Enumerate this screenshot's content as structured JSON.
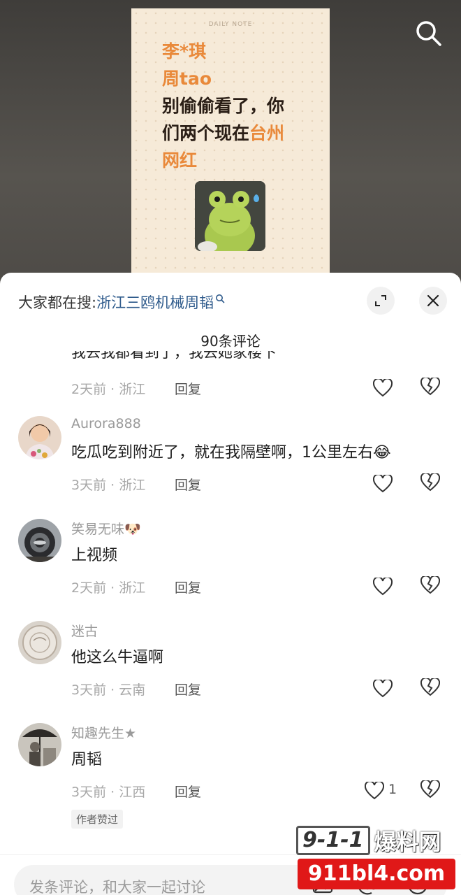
{
  "video": {
    "note_header": "DAILY NOTE",
    "lines": [
      {
        "parts": [
          {
            "text": "李*琪",
            "orange": true
          }
        ]
      },
      {
        "parts": [
          {
            "text": "周tao",
            "orange": true
          }
        ]
      },
      {
        "parts": [
          {
            "text": "别偷偷看了，你",
            "orange": false
          }
        ]
      },
      {
        "parts": [
          {
            "text": "们两个现在",
            "orange": false
          },
          {
            "text": "台州",
            "orange": true
          }
        ]
      },
      {
        "parts": [
          {
            "text": "网红",
            "orange": true
          }
        ]
      }
    ],
    "search_icon": "search-icon"
  },
  "sheet": {
    "hot_search_label": "大家都在搜:",
    "hot_search_query": "浙江三鸥机械周韬",
    "expand_icon": "expand-icon",
    "close_icon": "close-icon",
    "comment_count": "90条评论"
  },
  "partial_comment": {
    "text": "我去我都看到了，我去她家楼下",
    "meta": "2天前 · 浙江",
    "reply": "回复"
  },
  "comments": [
    {
      "name": "Aurora888",
      "text": "吃瓜吃到附近了，就在我隔壁啊，1公里左右😂",
      "meta": "3天前 · 浙江",
      "reply": "回复",
      "likes": "",
      "author_liked": ""
    },
    {
      "name": "笑易无味🐶",
      "text": "上视频",
      "meta": "2天前 · 浙江",
      "reply": "回复",
      "likes": "",
      "author_liked": ""
    },
    {
      "name": "迷古",
      "text": "他这么牛逼啊",
      "meta": "3天前 · 云南",
      "reply": "回复",
      "likes": "",
      "author_liked": ""
    },
    {
      "name": "知趣先生★",
      "text": "周韬",
      "meta": "3天前 · 江西",
      "reply": "回复",
      "likes": "1",
      "author_liked": "作者赞过"
    }
  ],
  "input": {
    "placeholder": "发条评论，和大家一起讨论"
  },
  "watermark": {
    "top_number": "9-1-1",
    "top_text": "爆料网",
    "bottom_text": "911bl4.com"
  },
  "colors": {
    "accent_orange": "#e9893a",
    "link_blue": "#2f5b8c",
    "watermark_red": "#e01818"
  }
}
